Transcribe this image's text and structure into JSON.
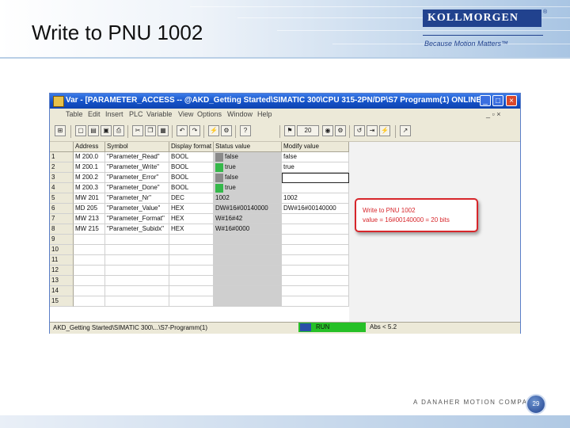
{
  "slide": {
    "title": "Write to PNU 1002",
    "logo": "KOLLMORGEN",
    "logo_reg": "®",
    "tagline": "Because Motion Matters™",
    "footer_company": "A DANAHER MOTION COMPANY",
    "page_number": "29"
  },
  "window": {
    "title": "Var - [PARAMETER_ACCESS -- @AKD_Getting Started\\SIMATIC 300\\CPU 315-2PN/DP\\S7 Programm(1) ONLINE]",
    "menu": [
      "Table",
      "Edit",
      "Insert",
      "PLC",
      "Variable",
      "View",
      "Options",
      "Window",
      "Help"
    ],
    "toolbar_text": "20",
    "columns": [
      "Address",
      "Symbol",
      "Display format",
      "Status value",
      "Modify value"
    ],
    "rows": [
      {
        "num": "1",
        "address": "M 200.0",
        "symbol": "\"Parameter_Read\"",
        "format": "BOOL",
        "status": "false",
        "modify": "false",
        "status_color": "#8a8a8a"
      },
      {
        "num": "2",
        "address": "M 200.1",
        "symbol": "\"Parameter_Write\"",
        "format": "BOOL",
        "status": "true",
        "modify": "true",
        "status_color": "#35b84a"
      },
      {
        "num": "3",
        "address": "M 200.2",
        "symbol": "\"Parameter_Error\"",
        "format": "BOOL",
        "status": "false",
        "modify": "",
        "status_color": "#8a8a8a"
      },
      {
        "num": "4",
        "address": "M 200.3",
        "symbol": "\"Parameter_Done\"",
        "format": "BOOL",
        "status": "true",
        "modify": "",
        "status_color": "#35b84a"
      },
      {
        "num": "5",
        "address": "MW 201",
        "symbol": "\"Parameter_Nr\"",
        "format": "DEC",
        "status": "1002",
        "modify": "1002",
        "status_color": ""
      },
      {
        "num": "6",
        "address": "MD 205",
        "symbol": "\"Parameter_Value\"",
        "format": "HEX",
        "status": "DW#16#00140000",
        "modify": "DW#16#00140000",
        "status_color": ""
      },
      {
        "num": "7",
        "address": "MW 213",
        "symbol": "\"Parameter_Format\"",
        "format": "HEX",
        "status": "W#16#42",
        "modify": "",
        "status_color": ""
      },
      {
        "num": "8",
        "address": "MW 215",
        "symbol": "\"Parameter_Subidx\"",
        "format": "HEX",
        "status": "W#16#0000",
        "modify": "",
        "status_color": ""
      },
      {
        "num": "9",
        "address": "",
        "symbol": "",
        "format": "",
        "status": "",
        "modify": "",
        "status_color": ""
      },
      {
        "num": "10",
        "address": "",
        "symbol": "",
        "format": "",
        "status": "",
        "modify": "",
        "status_color": ""
      },
      {
        "num": "11",
        "address": "",
        "symbol": "",
        "format": "",
        "status": "",
        "modify": "",
        "status_color": ""
      },
      {
        "num": "12",
        "address": "",
        "symbol": "",
        "format": "",
        "status": "",
        "modify": "",
        "status_color": ""
      },
      {
        "num": "13",
        "address": "",
        "symbol": "",
        "format": "",
        "status": "",
        "modify": "",
        "status_color": ""
      },
      {
        "num": "14",
        "address": "",
        "symbol": "",
        "format": "",
        "status": "",
        "modify": "",
        "status_color": ""
      },
      {
        "num": "15",
        "address": "",
        "symbol": "",
        "format": "",
        "status": "",
        "modify": "",
        "status_color": ""
      }
    ],
    "status_path": "AKD_Getting Started\\SIMATIC 300\\...\\S7-Programm(1)",
    "run_label": "RUN",
    "abs_label": "Abs < 5.2"
  },
  "callout": {
    "line1": "Write to PNU 1002",
    "line2": "value = 16#00140000 = 20 bits"
  }
}
